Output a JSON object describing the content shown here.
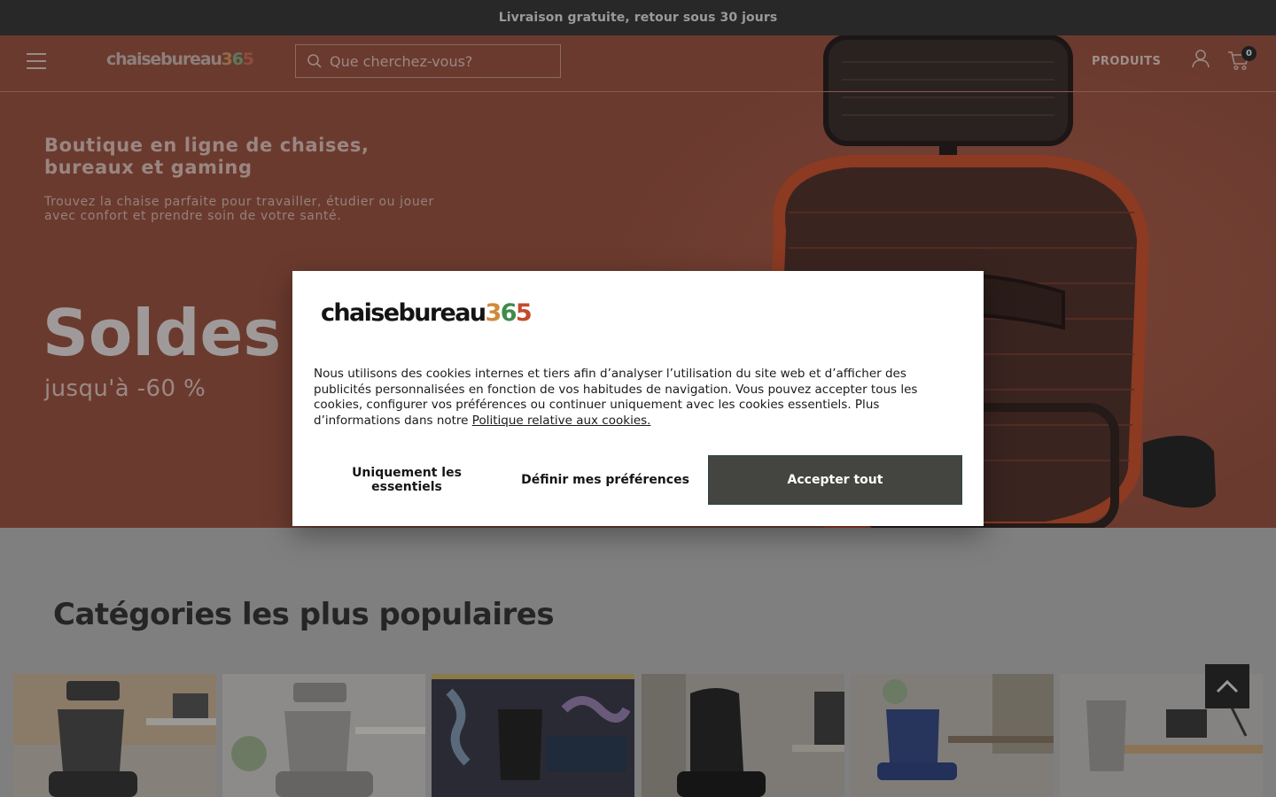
{
  "promo": {
    "text": "Livraison gratuite, retour sous 30 jours"
  },
  "header": {
    "logo": {
      "word": "chaisebureau",
      "d1": "3",
      "d2": "6",
      "d3": "5"
    },
    "search_placeholder": "Que cherchez-vous?",
    "nav_produits": "PRODUITS",
    "cart_count": "0"
  },
  "hero": {
    "title": "Boutique en ligne de chaises, bureaux et gaming",
    "subtitle": "Trouvez la chaise parfaite pour travailler, étudier ou jouer avec confort et prendre soin de votre santé.",
    "headline": "Soldes",
    "discount": "jusqu'à -60 %"
  },
  "categories": {
    "title": "Catégories les plus populaires"
  },
  "cookie_modal": {
    "logo": {
      "word": "chaisebureau",
      "d1": "3",
      "d2": "6",
      "d3": "5"
    },
    "text": "Nous utilisons des cookies internes et tiers afin d’analyser l’utilisation du site web et d’afficher des publicités personnalisées en fonction de vos habitudes de navigation. Vous pouvez accepter tous les cookies, configurer vos préférences ou continuer uniquement avec les cookies essentiels. Plus d’informations dans notre ",
    "policy_link": "Politique relative aux cookies.",
    "btn_essentials": "Uniquement les essentiels",
    "btn_prefs": "Définir mes préférences",
    "btn_accept": "Accepter tout"
  },
  "colors": {
    "promo_bg": "#282828",
    "hero_bg": "#6b3a2e",
    "accept_btn": "#444440",
    "overlay_page": "#7f7f80"
  }
}
